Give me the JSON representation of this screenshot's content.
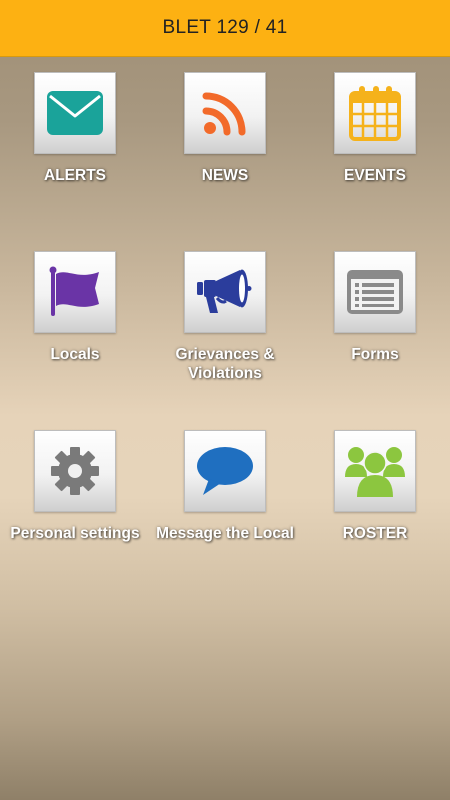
{
  "header": {
    "title": "BLET 129 / 41"
  },
  "tiles": [
    {
      "label": "ALERTS",
      "icon": "envelope-icon",
      "color": "#1aa39a"
    },
    {
      "label": "NEWS",
      "icon": "rss-icon",
      "color": "#f26a2a"
    },
    {
      "label": "EVENTS",
      "icon": "calendar-icon",
      "color": "#f5b21b"
    },
    {
      "label": "Locals",
      "icon": "flag-icon",
      "color": "#6a34a6"
    },
    {
      "label": "Grievances & Violations",
      "icon": "megaphone-icon",
      "color": "#2b3d9c"
    },
    {
      "label": "Forms",
      "icon": "form-icon",
      "color": "#8a8a8a"
    },
    {
      "label": "Personal settings",
      "icon": "gear-icon",
      "color": "#7a7a7a"
    },
    {
      "label": "Message the Local",
      "icon": "speech-bubble-icon",
      "color": "#1f6fc0"
    },
    {
      "label": "ROSTER",
      "icon": "people-group-icon",
      "color": "#8cc63f"
    }
  ]
}
